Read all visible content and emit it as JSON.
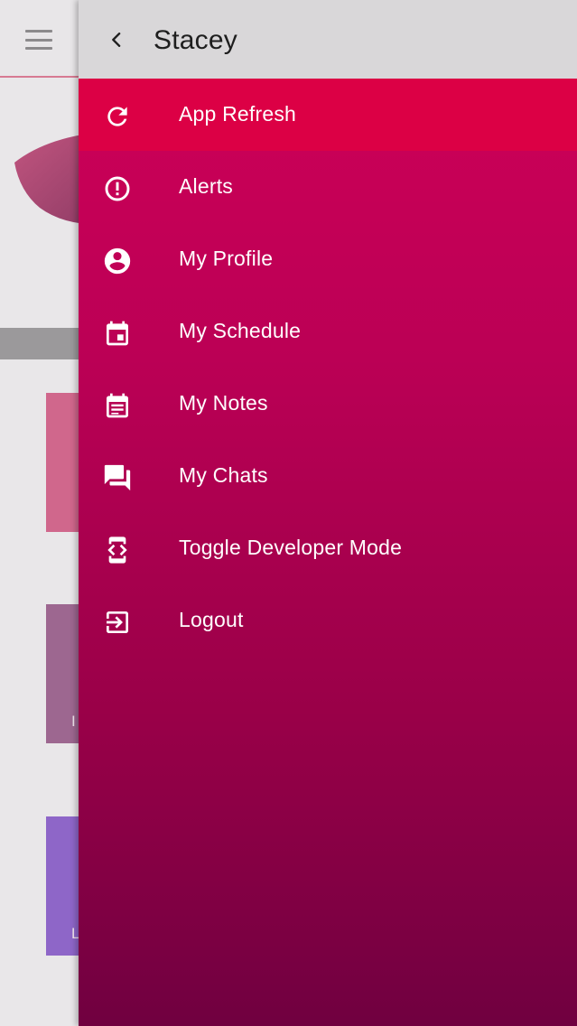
{
  "colors": {
    "drawer_gradient_top": "#d10058",
    "drawer_gradient_bottom": "#700040",
    "active_item": "#dc0045",
    "header_bg": "#d9d7d9"
  },
  "background": {
    "menu_icon": "hamburger-menu-icon",
    "tiles": [
      {
        "text": ""
      },
      {
        "text": "I"
      },
      {
        "text": "L"
      }
    ]
  },
  "drawer": {
    "back_icon": "chevron-left-icon",
    "title": "Stacey",
    "items": [
      {
        "label": "App Refresh",
        "icon": "refresh-icon",
        "active": true
      },
      {
        "label": "Alerts",
        "icon": "alert-circle-icon",
        "active": false
      },
      {
        "label": "My Profile",
        "icon": "account-circle-icon",
        "active": false
      },
      {
        "label": "My Schedule",
        "icon": "calendar-icon",
        "active": false
      },
      {
        "label": "My Notes",
        "icon": "notes-icon",
        "active": false
      },
      {
        "label": "My Chats",
        "icon": "chat-icon",
        "active": false
      },
      {
        "label": "Toggle Developer Mode",
        "icon": "developer-mode-icon",
        "active": false
      },
      {
        "label": "Logout",
        "icon": "logout-icon",
        "active": false
      }
    ]
  }
}
